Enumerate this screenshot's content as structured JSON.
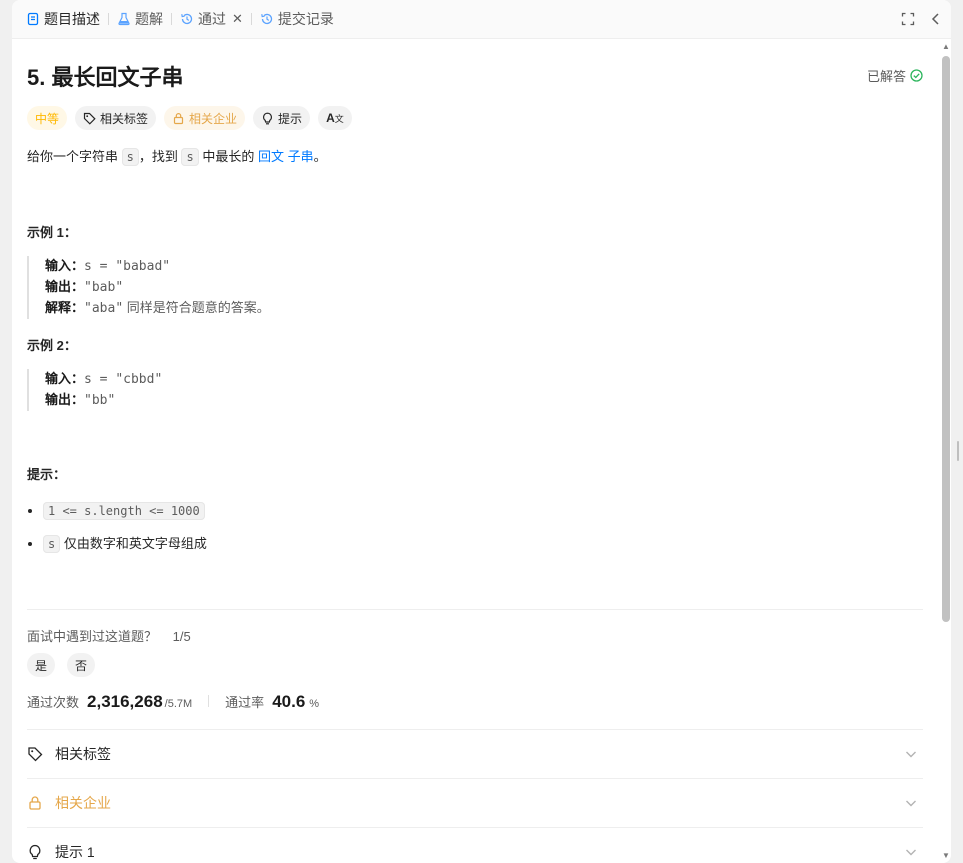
{
  "tabs": [
    {
      "label": "题目描述",
      "icon": "document-icon",
      "active": true
    },
    {
      "label": "题解",
      "icon": "flask-icon"
    },
    {
      "label": "通过",
      "icon": "history-icon",
      "closable": true
    },
    {
      "label": "提交记录",
      "icon": "history-icon"
    }
  ],
  "problem": {
    "title": "5. 最长回文子串",
    "solved_label": "已解答"
  },
  "tags": {
    "difficulty": "中等",
    "related_tags": "相关标签",
    "related_companies": "相关企业",
    "hint": "提示",
    "translate": "A"
  },
  "description": {
    "part1": "给你一个字符串 ",
    "var1": "s",
    "part2": "，找到 ",
    "var2": "s",
    "part3": " 中最长的 ",
    "link1": "回文",
    "link2": "子串",
    "part4": "。"
  },
  "examples": [
    {
      "title": "示例 1：",
      "input_label": "输入：",
      "input_value": "s = \"babad\"",
      "output_label": "输出：",
      "output_value": "\"bab\"",
      "explain_label": "解释：",
      "explain_code": "\"aba\"",
      "explain_text": " 同样是符合题意的答案。"
    },
    {
      "title": "示例 2：",
      "input_label": "输入：",
      "input_value": "s = \"cbbd\"",
      "output_label": "输出：",
      "output_value": "\"bb\""
    }
  ],
  "constraints": {
    "title": "提示：",
    "item1_code": "1 <= s.length <= 1000",
    "item2_code": "s",
    "item2_text": " 仅由数字和英文字母组成"
  },
  "interview": {
    "question": "面试中遇到过这道题？",
    "count": "1/5",
    "yes": "是",
    "no": "否"
  },
  "stats": {
    "accepted_label": "通过次数",
    "accepted_value": "2,316,268",
    "submissions": "/5.7M",
    "rate_label": "通过率",
    "rate_value": "40.6",
    "rate_unit": "%"
  },
  "accordions": [
    {
      "label": "相关标签",
      "icon": "tag-icon"
    },
    {
      "label": "相关企业",
      "icon": "lock-icon"
    },
    {
      "label": "提示 1",
      "icon": "lightbulb-icon"
    }
  ],
  "colors": {
    "difficulty_medium": "#ffb800",
    "link": "#007aff",
    "company": "#e5a74a",
    "solved_check": "#2db55d"
  }
}
